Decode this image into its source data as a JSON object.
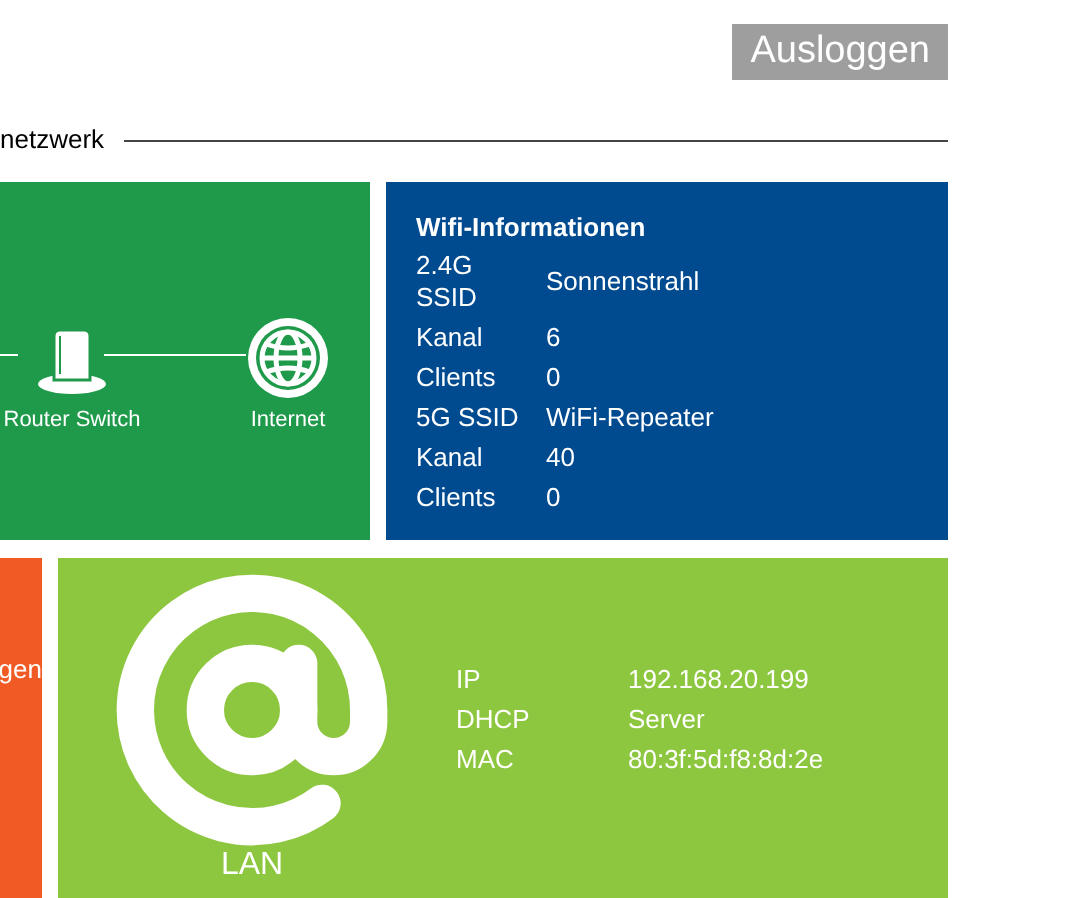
{
  "logout_button": "Ausloggen",
  "section_title": "netzwerk",
  "topology": {
    "nodes": [
      {
        "kind": "router",
        "label": "Router Switch"
      },
      {
        "kind": "globe",
        "label": "Internet"
      }
    ]
  },
  "wifi": {
    "title": "Wifi-Informationen",
    "rows": [
      {
        "label": "2.4G SSID",
        "value": "Sonnenstrahl"
      },
      {
        "label": "Kanal",
        "value": "6"
      },
      {
        "label": "Clients",
        "value": "0"
      },
      {
        "label": "5G SSID",
        "value": "WiFi-Repeater"
      },
      {
        "label": "Kanal",
        "value": "40"
      },
      {
        "label": "Clients",
        "value": "0"
      }
    ]
  },
  "side_tile": {
    "label": "gen"
  },
  "lan": {
    "label": "LAN",
    "rows": [
      {
        "label": "IP",
        "value": "192.168.20.199"
      },
      {
        "label": "DHCP",
        "value": "Server"
      },
      {
        "label": "MAC",
        "value": "80:3f:5d:f8:8d:2e"
      }
    ]
  }
}
